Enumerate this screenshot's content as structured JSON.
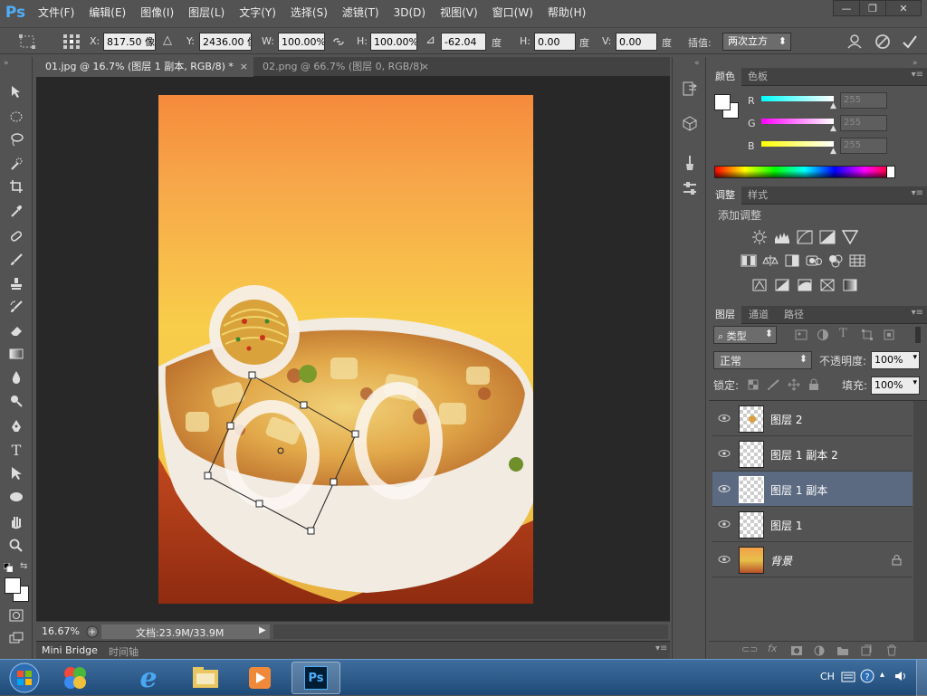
{
  "app": {
    "logo": "Ps"
  },
  "menu": [
    "文件(F)",
    "编辑(E)",
    "图像(I)",
    "图层(L)",
    "文字(Y)",
    "选择(S)",
    "滤镜(T)",
    "3D(D)",
    "视图(V)",
    "窗口(W)",
    "帮助(H)"
  ],
  "window_buttons": {
    "minimize": "—",
    "restore": "❐",
    "close": "✕"
  },
  "options": {
    "x_label": "X:",
    "x_value": "817.50 像",
    "y_label": "Y:",
    "y_value": "2436.00 像",
    "w_label": "W:",
    "w_value": "100.00%",
    "h_label": "H:",
    "h_value": "100.00%",
    "angle_value": "-62.04",
    "angle_unit": "度",
    "hskew_label": "H:",
    "hskew_value": "0.00",
    "hskew_unit": "度",
    "vskew_label": "V:",
    "vskew_value": "0.00",
    "vskew_unit": "度",
    "interp_label": "插值:",
    "interp_value": "两次立方"
  },
  "tabs": [
    {
      "label": "01.jpg @ 16.7% (图层 1 副本, RGB/8) *",
      "active": true
    },
    {
      "label": "02.png @ 66.7% (图层 0, RGB/8)",
      "active": false
    }
  ],
  "status": {
    "zoom": "16.67%",
    "doc": "文档:23.9M/33.9M"
  },
  "bottom_tabs": [
    "Mini Bridge",
    "时间轴"
  ],
  "color_panel": {
    "tabs": [
      "颜色",
      "色板"
    ],
    "r_label": "R",
    "g_label": "G",
    "b_label": "B",
    "r_value": "255",
    "g_value": "255",
    "b_value": "255"
  },
  "adjust_panel": {
    "tabs": [
      "调整",
      "样式"
    ],
    "title": "添加调整"
  },
  "layers_panel": {
    "tabs": [
      "图层",
      "通道",
      "路径"
    ],
    "filter_label": "类型",
    "blend_mode": "正常",
    "opacity_label": "不透明度:",
    "opacity_value": "100%",
    "lock_label": "锁定:",
    "fill_label": "填充:",
    "fill_value": "100%",
    "layers": [
      {
        "name": "图层 2",
        "selected": false
      },
      {
        "name": "图层 1 副本 2",
        "selected": false
      },
      {
        "name": "图层 1 副本",
        "selected": true
      },
      {
        "name": "图层 1",
        "selected": false
      },
      {
        "name": "背景",
        "selected": false,
        "locked": true
      }
    ]
  },
  "taskbar": {
    "lang": "CH"
  },
  "colors": {
    "ps_blue": "#4faef8",
    "panel": "#535353",
    "selected_layer": "#5b6a80"
  }
}
